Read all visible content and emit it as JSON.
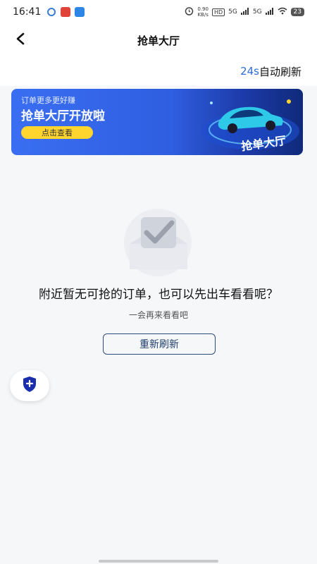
{
  "status_bar": {
    "time": "16:41",
    "net_speed_value": "0.90",
    "net_speed_unit": "KB/s",
    "hd_label": "HD",
    "signal_1": "5G",
    "signal_2": "5G",
    "battery": "23"
  },
  "nav": {
    "title": "抢单大厅"
  },
  "refresh": {
    "countdown": "24s",
    "label": "自动刷新"
  },
  "banner": {
    "subtitle": "订单更多更好赚",
    "title": "抢单大厅开放啦",
    "button_label": "点击查看",
    "art_label": "抢单大厅"
  },
  "empty_state": {
    "title": "附近暂无可抢的订单，也可以先出车看看呢？",
    "subtitle": "一会再来看看吧",
    "refresh_button": "重新刷新"
  },
  "colors": {
    "accent_blue": "#2f6bd8",
    "banner_button": "#ffd52e",
    "fab_icon": "#1a2fb0"
  }
}
